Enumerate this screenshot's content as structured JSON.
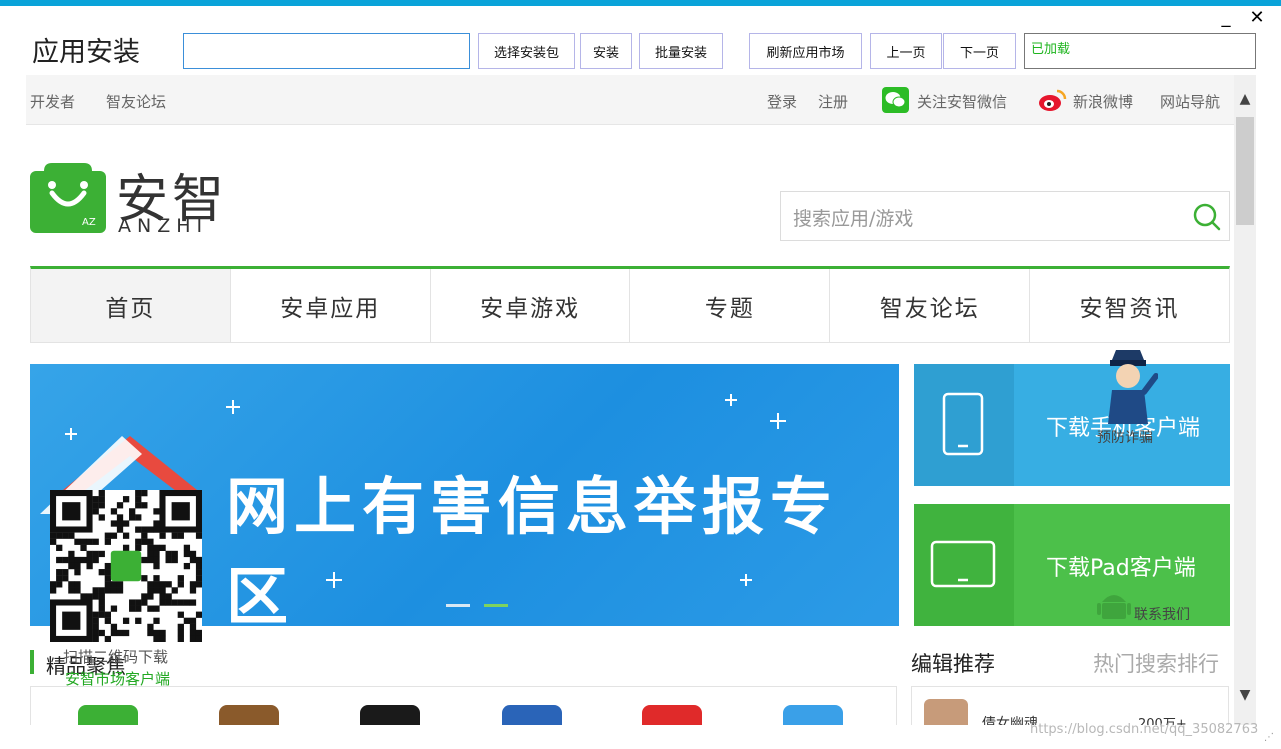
{
  "window": {
    "title": "应用安装",
    "minimize": "_",
    "close": "✕"
  },
  "toolbar": {
    "search_value": "",
    "buttons": [
      "选择安装包",
      "安装",
      "批量安装",
      "刷新应用市场",
      "上一页",
      "下一页"
    ],
    "status": "已加载"
  },
  "site": {
    "top_left": [
      "开发者",
      "智友论坛"
    ],
    "top_right": {
      "login": "登录",
      "register": "注册",
      "wechat": "关注安智微信",
      "weibo": "新浪微博",
      "sitenav": "网站导航"
    },
    "logo_text": "安智",
    "logo_sub": "ANZHI",
    "logo_badge": "AZ",
    "search_placeholder": "搜索应用/游戏",
    "nav_tabs": [
      "首页",
      "安卓应用",
      "安卓游戏",
      "专题",
      "智友论坛",
      "安智资讯"
    ],
    "banner_text": "网上有害信息举报专区",
    "download_phone": "下载手机客户端",
    "download_pad": "下载Pad客户端",
    "police_text": "预防诈骗",
    "contact_text": "联系我们",
    "qr_caption": "扫描二维码下载",
    "qr_caption2": "安智市场客户端",
    "section_featured": "精品聚焦",
    "section_editor": "编辑推荐",
    "section_hot": "热门搜索排行",
    "rec_item": {
      "name": "倩女幽魂",
      "count": "200万+"
    }
  },
  "colors": {
    "accent_green": "#3cb035",
    "banner_blue": "#2a9be6",
    "phone_card": "#37aee3",
    "pad_card": "#4cc04a"
  },
  "watermark": "https://blog.csdn.net/qq_35082763"
}
